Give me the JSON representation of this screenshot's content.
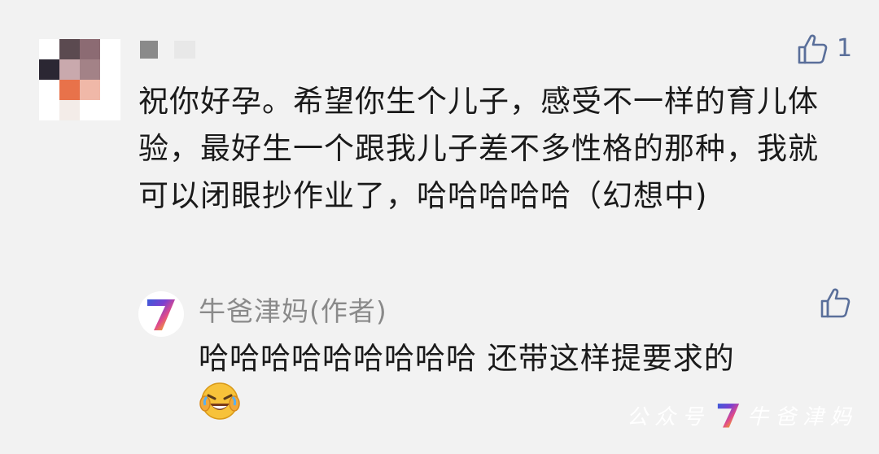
{
  "comment": {
    "author_masked": "",
    "text": "祝你好孕。希望你生个儿子，感受不一样的育儿体验，最好生一个跟我儿子差不多性格的那种，我就可以闭眼抄作业了，哈哈哈哈哈（幻想中)",
    "like_count": "1",
    "avatar_pixels": [
      "#ffffff",
      "#5b4a50",
      "#8c6b73",
      "#ffffff",
      "#2b2733",
      "#c9a9ad",
      "#a38287",
      "#ffffff",
      "#ffffff",
      "#e8724a",
      "#f0b8a8",
      "#ffffff",
      "#ffffff",
      "#f3ece8",
      "#ffffff",
      "#ffffff"
    ]
  },
  "reply": {
    "author": "牛爸津妈(作者)",
    "avatar_glyph": "7",
    "text": "哈哈哈哈哈哈哈哈哈 还带这样提要求的",
    "emoji": "laughing-crying-emoji"
  },
  "watermark": {
    "prefix": "公众号",
    "logo": "7",
    "suffix": "牛爸津妈"
  },
  "colors": {
    "background": "#f2f2f2",
    "like_icon": "#5a6f9a",
    "author_name": "#8a8a8a",
    "text": "#1a1a1a"
  }
}
